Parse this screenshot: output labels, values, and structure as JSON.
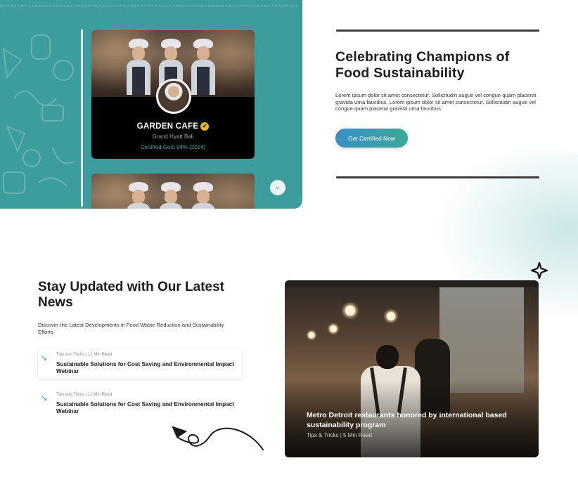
{
  "champions_card": {
    "name": "GARDEN CAFE",
    "location": "Grand Hyatt Bali",
    "certification": "Certified Gold 94% (2024)"
  },
  "champions": {
    "title": "Celebrating Champions of Food Sustainability",
    "body": "Lorem ipsum dolor sit amet consectetur. Sollicitudin augue vel congue quam placerat gravida urna faucibus. Lorem ipsum dolor sit amet consectetur. Sollicitudin augue vel congue quam placerat gravida urna faucibus.",
    "cta_label": "Get Certified Now"
  },
  "news": {
    "title": "Stay Updated with Our Latest News",
    "description": "Discover the Latest Developments in Food Waste Reduction and Sustainability Efforts",
    "items": [
      {
        "meta": "Tips and Tricks | 12 Min Read",
        "title": "Sustainable Solutions for Cost Saving and Environmental Impact Webinar"
      },
      {
        "meta": "Tips and Tricks | 12 Min Read",
        "title": "Sustainable Solutions for Cost Saving and Environmental Impact Webinar"
      }
    ],
    "featured": {
      "title": "Metro Detroit restaurants honored by international based sustainability program",
      "meta": "Tips & Tricks | 5 Min Read"
    }
  },
  "icons": {
    "verified": "verified-badge-icon",
    "scroll": "chevron-down-icon",
    "news_arrow": "arrow-down-right-icon",
    "decoration_star": "sparkle-icon",
    "decoration_curl": "curly-arrow-icon"
  },
  "colors": {
    "teal_panel": "#3d9c9c",
    "button_gradient_start": "#3a8fc7",
    "button_gradient_end": "#3aaa95",
    "certified_text": "#3aa7a7"
  }
}
